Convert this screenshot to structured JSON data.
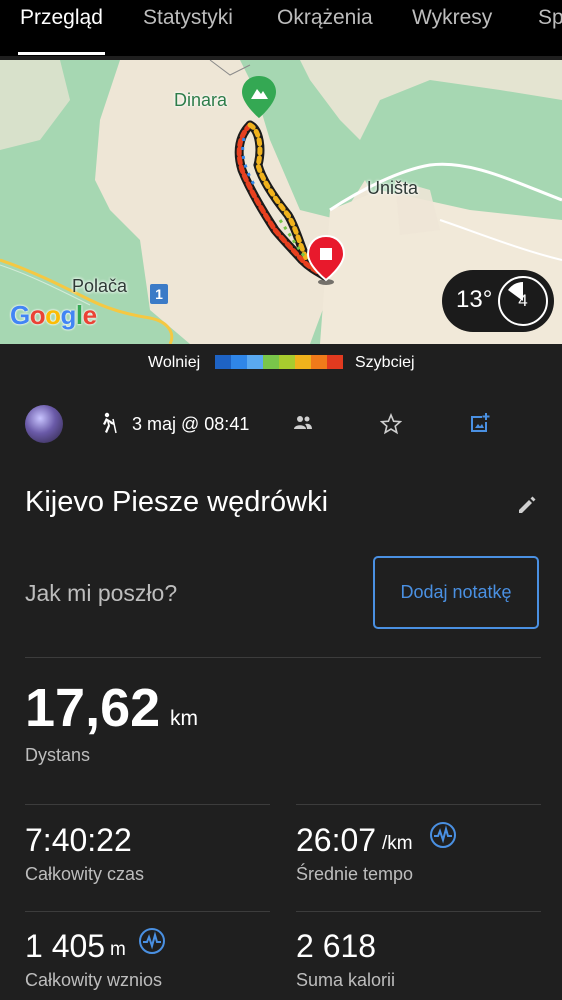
{
  "tabs": [
    "Przegląd",
    "Statystyki",
    "Okrążenia",
    "Wykresy",
    "Sp"
  ],
  "map": {
    "labels": {
      "peak": "Dinara",
      "town1": "Uništa",
      "town2": "Polača"
    },
    "road_number": "1",
    "attribution": "Google"
  },
  "weather": {
    "temperature": "13°",
    "wind": "4"
  },
  "legend": {
    "slow": "Wolniej",
    "fast": "Szybciej",
    "colors": [
      "#1e63c4",
      "#2f86e8",
      "#5aa9f0",
      "#79c64a",
      "#a8cc2e",
      "#f0b21c",
      "#f07a1a",
      "#e13a1f"
    ]
  },
  "activity": {
    "date": "3 maj @ 08:41",
    "title": "Kijevo Piesze wędrówki",
    "prompt": "Jak mi poszło?",
    "add_note": "Dodaj notatkę"
  },
  "stats": {
    "distance": {
      "value": "17,62",
      "unit": "km",
      "label": "Dystans"
    },
    "total_time": {
      "value": "7:40:22",
      "label": "Całkowity czas"
    },
    "avg_pace": {
      "value": "26:07",
      "unit": "/km",
      "label": "Średnie tempo"
    },
    "total_ascent": {
      "value": "1 405",
      "unit": "m",
      "label": "Całkowity wznios"
    },
    "calories": {
      "value": "2 618",
      "label": "Suma kalorii"
    }
  },
  "colors": {
    "accent": "#4a90e2",
    "background": "#1f1f1f",
    "map_green": "#a6d7b2",
    "pin_red": "#e8192c"
  }
}
